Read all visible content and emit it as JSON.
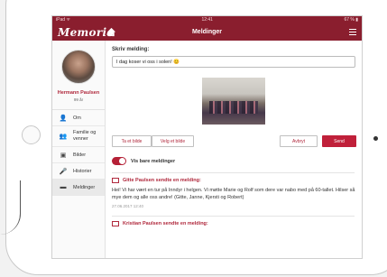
{
  "status_bar": {
    "left": "iPad ᯤ",
    "center": "12:41",
    "right": "67 % ▮"
  },
  "navbar": {
    "logo": "Memoria",
    "title": "Meldinger",
    "home_icon": "home-icon",
    "menu_icon": "menu-icon"
  },
  "profile": {
    "name": "Hermann Paulsen",
    "age": "99 år"
  },
  "sidebar": {
    "items": [
      {
        "label": "Om",
        "icon": "person-icon"
      },
      {
        "label": "Familie og venner",
        "icon": "people-icon"
      },
      {
        "label": "Bilder",
        "icon": "picture-icon"
      },
      {
        "label": "Historier",
        "icon": "mic-icon"
      },
      {
        "label": "Meldinger",
        "icon": "chat-icon"
      }
    ]
  },
  "compose": {
    "label": "Skriv melding:",
    "value": "I dag koser vi oss i solen! 😊",
    "take_photo": "Ta et bilde",
    "choose_photo": "Velg et bilde",
    "cancel": "Avbryt",
    "send": "Send"
  },
  "filter": {
    "label": "Vis bare meldinger"
  },
  "feed": [
    {
      "title": "Gitte Paulsen sendte en melding:",
      "text": "Hei! Vi har vært en tur på Inndyr i helgen. Vi møtte Marie og Rolf som dere var nabo med på 60-tallet. Hilser så mye dem og alle oss andre! (Gitte, Janne, Kjersti og Robert)",
      "date": "27.06.2017 12:40"
    },
    {
      "title": "Kristian Paulsen sendte en melding:",
      "text": "",
      "date": ""
    }
  ],
  "colors": {
    "brand": "#8a1e2e",
    "accent": "#c0203a"
  }
}
